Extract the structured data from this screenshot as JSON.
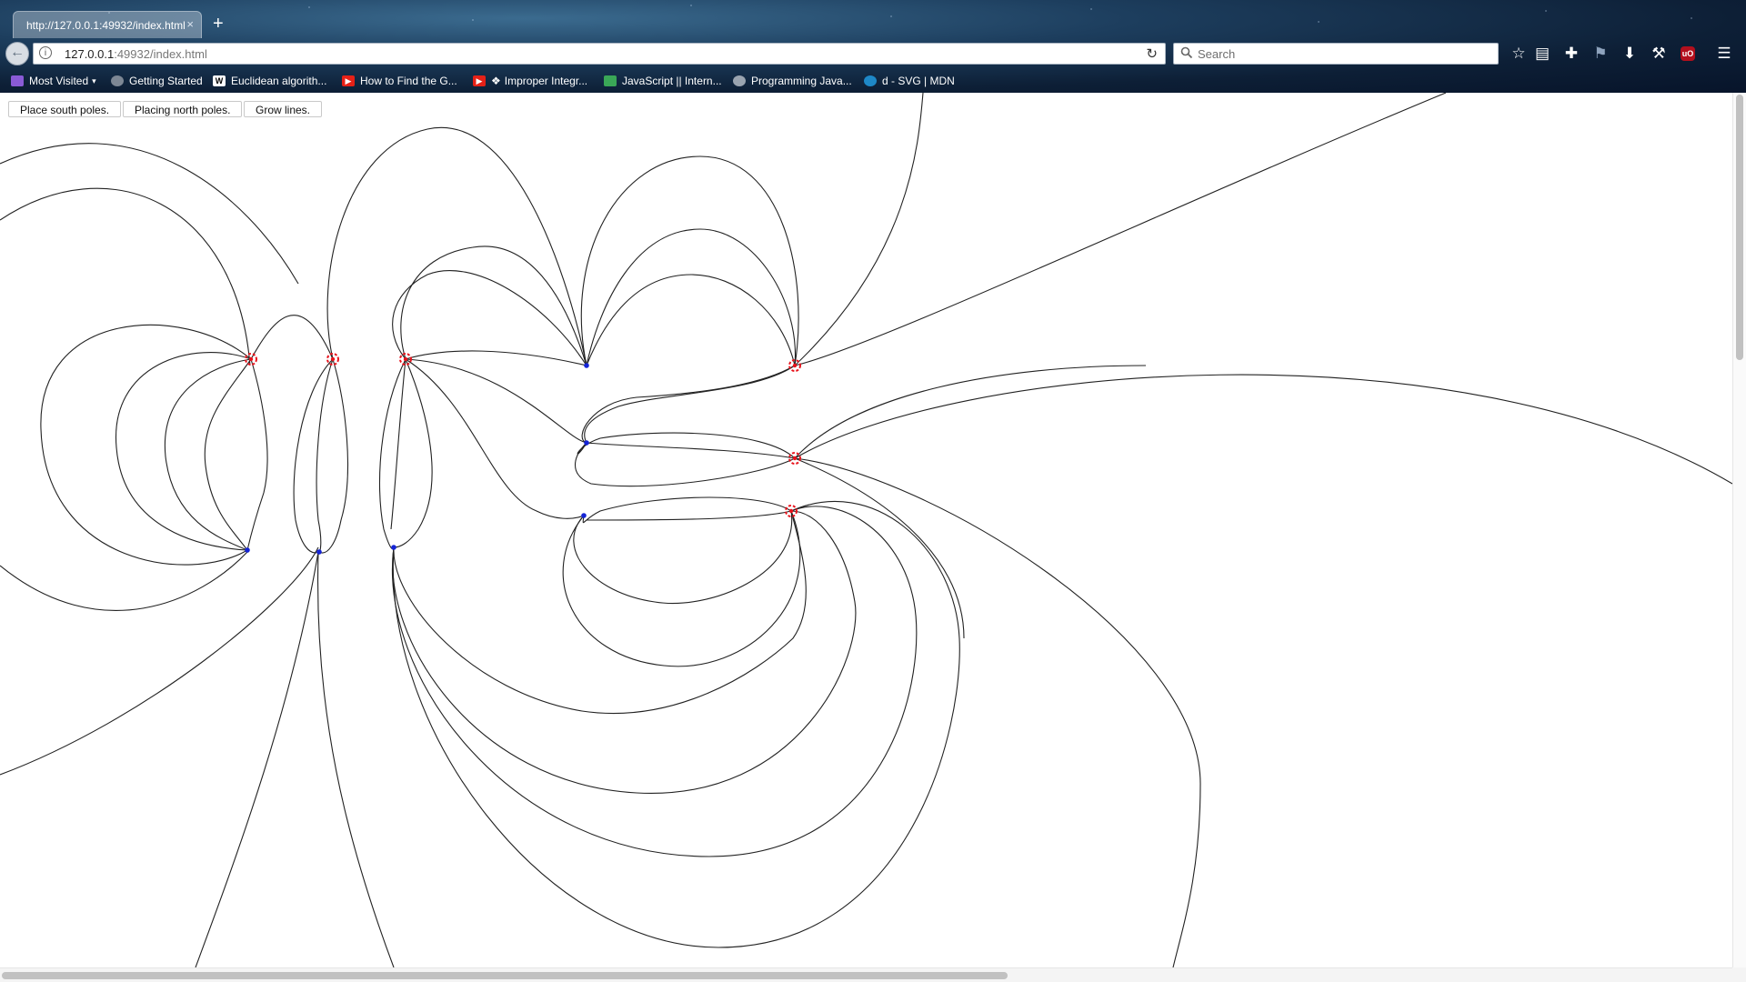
{
  "browser": {
    "tab": {
      "title": "http://127.0.0.1:49932/index.html",
      "close_icon": "×"
    },
    "new_tab_icon": "+",
    "url": {
      "host": "127.0.0.1",
      "rest": ":49932/index.html"
    },
    "search_placeholder": "Search",
    "toolbar_icons": [
      "star-icon",
      "reading-list-icon",
      "puzzle-icon",
      "flag-icon",
      "download-icon",
      "wrench-icon",
      "ublock-icon",
      "menu-icon"
    ],
    "ublock_label": "uO"
  },
  "bookmarks": [
    {
      "label": "Most Visited",
      "icon": "most-visited-icon",
      "color": "#8a5bd6"
    },
    {
      "label": "Getting Started",
      "icon": "firefox-icon",
      "color": "#7d8794"
    },
    {
      "label": "Euclidean algorith...",
      "icon": "wikipedia-icon",
      "color": "#ffffff"
    },
    {
      "label": "How to Find the G...",
      "icon": "youtube-icon",
      "color": "#e62117"
    },
    {
      "label": "Improper Integr...",
      "icon": "youtube-icon",
      "color": "#e62117"
    },
    {
      "label": "JavaScript || Intern...",
      "icon": "green-icon",
      "color": "#3aa757"
    },
    {
      "label": "Programming Java...",
      "icon": "gear-bookmark-icon",
      "color": "#9aa4b0"
    },
    {
      "label": "d - SVG | MDN",
      "icon": "mdn-icon",
      "color": "#1e88c7"
    }
  ],
  "page": {
    "buttons": [
      {
        "label": "Place south poles."
      },
      {
        "label": "Placing north poles."
      },
      {
        "label": "Grow lines."
      }
    ],
    "colors": {
      "north_pole": "#e8121b",
      "south_pole": "#1524d6",
      "field_line": "#222222"
    }
  }
}
